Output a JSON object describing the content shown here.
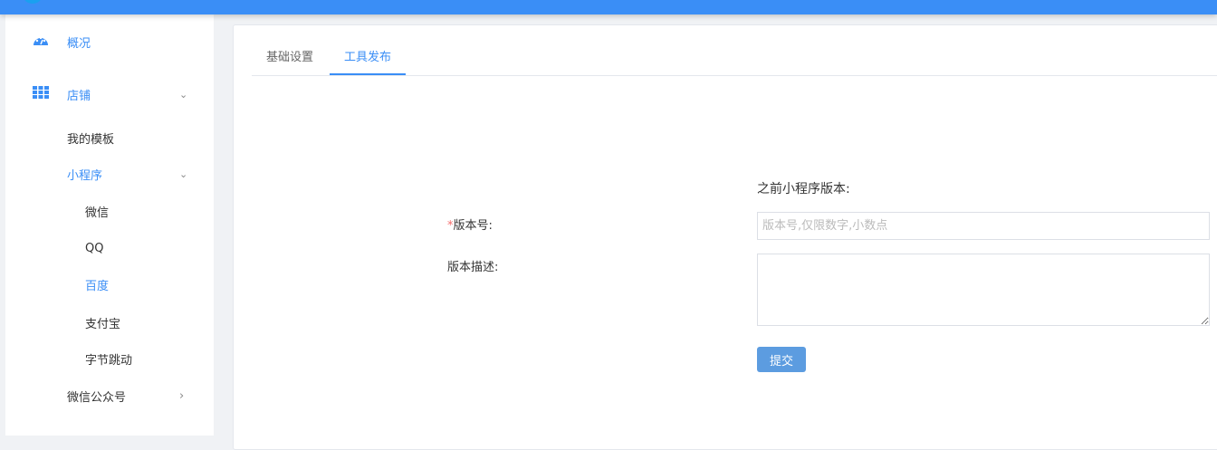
{
  "sidebar": {
    "overview": "概况",
    "store": "店铺",
    "my_templates": "我的模板",
    "mini_program": "小程序",
    "wechat": "微信",
    "qq": "QQ",
    "baidu": "百度",
    "alipay": "支付宝",
    "bytedance": "字节跳动",
    "official_account": "微信公众号"
  },
  "tabs": [
    "基础设置",
    "工具发布"
  ],
  "form": {
    "previous_version_label": "之前小程序版本:",
    "required_mark": "*",
    "version_label": "版本号:",
    "version_placeholder": "版本号,仅限数字,小数点",
    "version_value": "",
    "description_label": "版本描述:",
    "description_value": "",
    "submit": "提交"
  },
  "colors": {
    "accent": "#3a8ef6",
    "button": "#5c9ce0"
  }
}
